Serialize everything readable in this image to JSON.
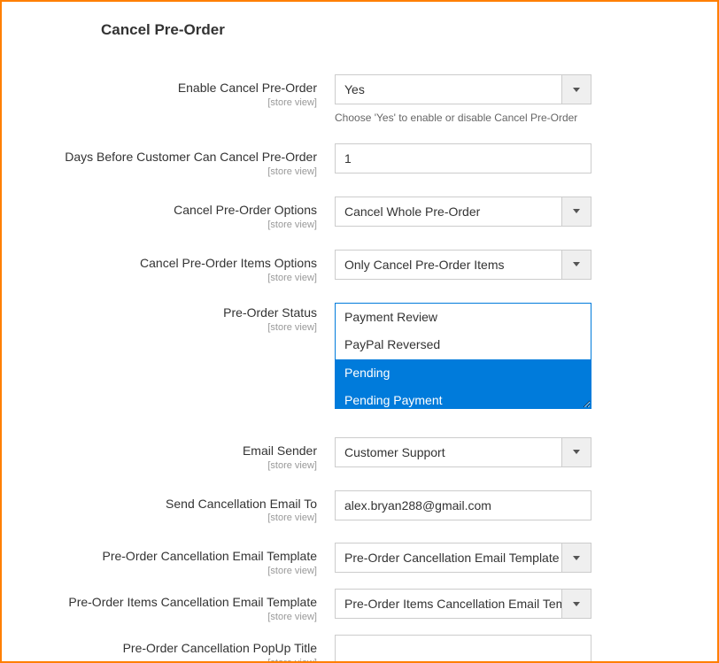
{
  "section": {
    "title": "Cancel Pre-Order"
  },
  "scope_label": "[store view]",
  "fields": {
    "enable": {
      "label": "Enable Cancel Pre-Order",
      "value": "Yes",
      "help": "Choose 'Yes' to enable or disable Cancel Pre-Order"
    },
    "days_before": {
      "label": "Days Before Customer Can Cancel Pre-Order",
      "value": "1"
    },
    "cancel_options": {
      "label": "Cancel Pre-Order Options",
      "value": "Cancel Whole Pre-Order"
    },
    "cancel_items_options": {
      "label": "Cancel Pre-Order Items Options",
      "value": "Only Cancel Pre-Order Items"
    },
    "status": {
      "label": "Pre-Order Status",
      "options": [
        {
          "label": "Payment Review",
          "selected": false
        },
        {
          "label": "PayPal Reversed",
          "selected": false
        },
        {
          "label": "Pending",
          "selected": true
        },
        {
          "label": "Pending Payment",
          "selected": true
        }
      ]
    },
    "email_sender": {
      "label": "Email Sender",
      "value": "Customer Support"
    },
    "send_email_to": {
      "label": "Send Cancellation Email To",
      "value": "alex.bryan288@gmail.com"
    },
    "cancel_email_template": {
      "label": "Pre-Order Cancellation Email Template",
      "value": "Pre-Order Cancellation Email Template (D"
    },
    "items_cancel_email_template": {
      "label": "Pre-Order Items Cancellation Email Template",
      "value": "Pre-Order Items Cancellation Email Temp"
    },
    "popup_title": {
      "label": "Pre-Order Cancellation PopUp Title",
      "value": ""
    }
  }
}
